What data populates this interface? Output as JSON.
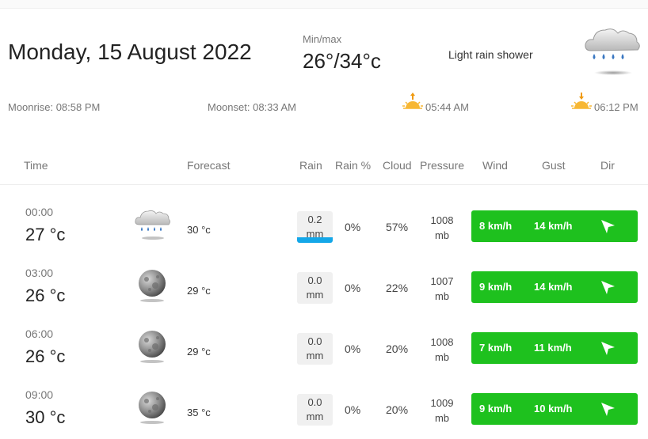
{
  "header": {
    "date": "Monday, 15 August 2022",
    "minmax_label": "Min/max",
    "minmax_value": "26°/34°c",
    "condition": "Light rain shower",
    "condition_icon": "rain-cloud-icon"
  },
  "astro": {
    "moonrise": "Moonrise: 08:58 PM",
    "moonset": "Moonset: 08:33 AM",
    "sunrise": "05:44 AM",
    "sunset": "06:12 PM",
    "sunrise_icon": "sunrise-icon",
    "sunset_icon": "sunset-icon"
  },
  "columns": [
    "Time",
    "Forecast",
    "Rain",
    "Rain %",
    "Cloud",
    "Pressure",
    "Wind",
    "Gust",
    "Dir"
  ],
  "rows": [
    {
      "time": "00:00",
      "temp": "27 °c",
      "icon": "rain-cloud-icon",
      "forecast": "30 °c",
      "rain": "0.2",
      "rain_unit": "mm",
      "rain_level": 0.2,
      "rain_pct": "0%",
      "cloud": "57%",
      "pressure": "1008",
      "pressure_unit": "mb",
      "wind": "8 km/h",
      "gust": "14 km/h",
      "dir_icon": "wind-direction-arrow-icon"
    },
    {
      "time": "03:00",
      "temp": "26 °c",
      "icon": "moon-icon",
      "forecast": "29 °c",
      "rain": "0.0",
      "rain_unit": "mm",
      "rain_level": 0.0,
      "rain_pct": "0%",
      "cloud": "22%",
      "pressure": "1007",
      "pressure_unit": "mb",
      "wind": "9 km/h",
      "gust": "14 km/h",
      "dir_icon": "wind-direction-arrow-icon"
    },
    {
      "time": "06:00",
      "temp": "26 °c",
      "icon": "moon-icon",
      "forecast": "29 °c",
      "rain": "0.0",
      "rain_unit": "mm",
      "rain_level": 0.0,
      "rain_pct": "0%",
      "cloud": "20%",
      "pressure": "1008",
      "pressure_unit": "mb",
      "wind": "7 km/h",
      "gust": "11 km/h",
      "dir_icon": "wind-direction-arrow-icon"
    },
    {
      "time": "09:00",
      "temp": "30 °c",
      "icon": "moon-icon",
      "forecast": "35 °c",
      "rain": "0.0",
      "rain_unit": "mm",
      "rain_level": 0.0,
      "rain_pct": "0%",
      "cloud": "20%",
      "pressure": "1009",
      "pressure_unit": "mb",
      "wind": "9 km/h",
      "gust": "10 km/h",
      "dir_icon": "wind-direction-arrow-icon"
    }
  ],
  "colors": {
    "wind_bar": "#1ec11e",
    "rain_bar": "#14a7e8",
    "rain_box": "#f0f0f0"
  }
}
